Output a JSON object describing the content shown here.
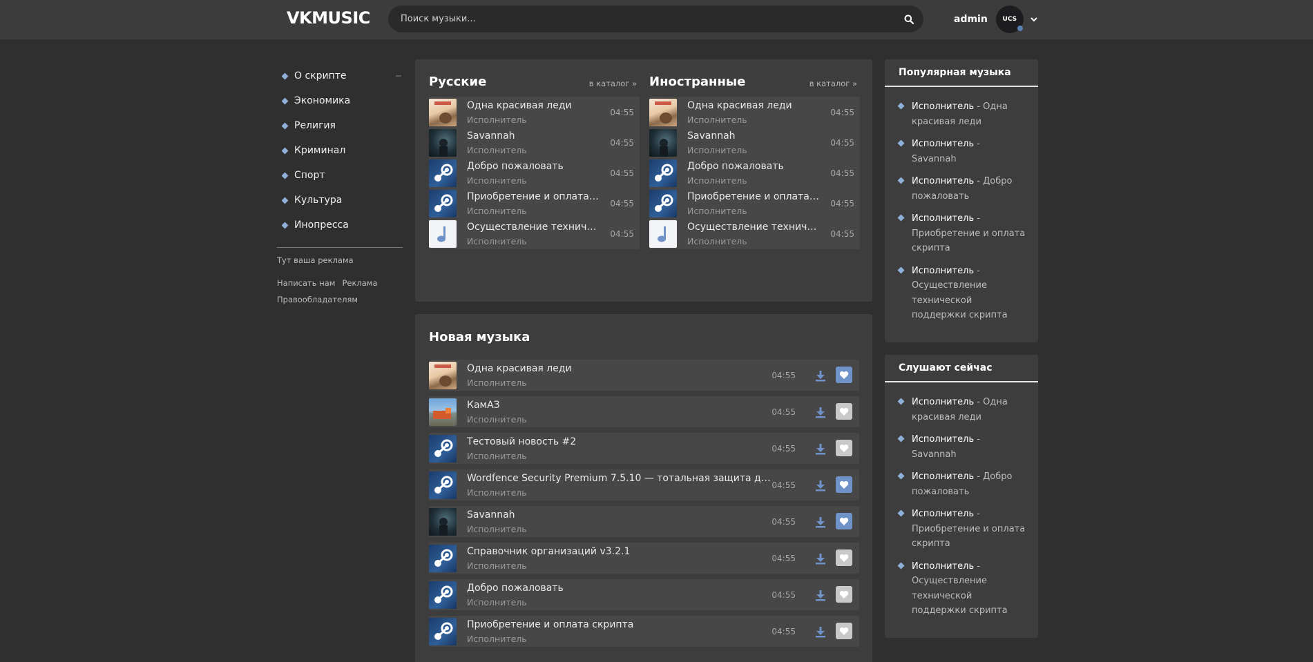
{
  "header": {
    "logo": "VKMUSIC",
    "search_placeholder": "Поиск музыки...",
    "user_name": "admin",
    "avatar_text": "UCS"
  },
  "sidebar": {
    "items": [
      {
        "label": "О скрипте"
      },
      {
        "label": "Экономика"
      },
      {
        "label": "Религия"
      },
      {
        "label": "Криминал"
      },
      {
        "label": "Спорт"
      },
      {
        "label": "Культура"
      },
      {
        "label": "Инопресса"
      }
    ],
    "ad_text": "Тут ваша реклама",
    "links": [
      "Написать нам",
      "Реклама",
      "Правообладателям"
    ]
  },
  "top": {
    "left_title": "Русские",
    "right_title": "Иностранные",
    "catalog_link": "в каталог »",
    "tracks": [
      {
        "title": "Одна красивая леди",
        "artist": "Исполнитель",
        "time": "04:55",
        "art": "lady"
      },
      {
        "title": "Savannah",
        "artist": "Исполнитель",
        "time": "04:55",
        "art": "sav"
      },
      {
        "title": "Добро пожаловать",
        "artist": "Исполнитель",
        "time": "04:55",
        "art": "steam"
      },
      {
        "title": "Приобретение и оплата с...",
        "artist": "Исполнитель",
        "time": "04:55",
        "art": "steam"
      },
      {
        "title": "Осуществление техничес...",
        "artist": "Исполнитель",
        "time": "04:55",
        "art": "note"
      }
    ]
  },
  "new_music": {
    "title": "Новая музыка",
    "tracks": [
      {
        "title": "Одна красивая леди",
        "artist": "Исполнитель",
        "time": "04:55",
        "art": "lady",
        "liked": true
      },
      {
        "title": "КамАЗ",
        "artist": "Исполнитель",
        "time": "04:55",
        "art": "kamaz",
        "liked": false
      },
      {
        "title": "Тестовый новость #2",
        "artist": "Исполнитель",
        "time": "04:55",
        "art": "steam",
        "liked": false
      },
      {
        "title": "Wordfence Security Premium 7.5.10 — тотальная защита для ...",
        "artist": "Исполнитель",
        "time": "04:55",
        "art": "steam",
        "liked": true
      },
      {
        "title": "Savannah",
        "artist": "Исполнитель",
        "time": "04:55",
        "art": "sav",
        "liked": true
      },
      {
        "title": "Справочник организаций v3.2.1",
        "artist": "Исполнитель",
        "time": "04:55",
        "art": "steam",
        "liked": false
      },
      {
        "title": "Добро пожаловать",
        "artist": "Исполнитель",
        "time": "04:55",
        "art": "steam",
        "liked": false
      },
      {
        "title": "Приобретение и оплата скрипта",
        "artist": "Исполнитель",
        "time": "04:55",
        "art": "steam",
        "liked": false
      }
    ]
  },
  "popular": {
    "title": "Популярная музыка",
    "items": [
      {
        "artist": "Исполнитель",
        "sep": " - ",
        "song": "Одна красивая леди"
      },
      {
        "artist": "Исполнитель",
        "sep": " - ",
        "song": "Savannah"
      },
      {
        "artist": "Исполнитель",
        "sep": " - ",
        "song": "Добро пожаловать"
      },
      {
        "artist": "Исполнитель",
        "sep": " - ",
        "song": "Приобретение и оплата скрипта"
      },
      {
        "artist": "Исполнитель",
        "sep": " - ",
        "song": "Осуществление технической поддержки скрипта"
      }
    ]
  },
  "listening": {
    "title": "Слушают сейчас",
    "items": [
      {
        "artist": "Исполнитель",
        "sep": " - ",
        "song": "Одна красивая леди"
      },
      {
        "artist": "Исполнитель",
        "sep": " - ",
        "song": "Savannah"
      },
      {
        "artist": "Исполнитель",
        "sep": " - ",
        "song": "Добро пожаловать"
      },
      {
        "artist": "Исполнитель",
        "sep": " - ",
        "song": "Приобретение и оплата скрипта"
      },
      {
        "artist": "Исполнитель",
        "sep": " - ",
        "song": "Осуществление технической поддержки скрипта"
      }
    ]
  },
  "colors": {
    "background": "#2f2f2f",
    "panel": "#3d3d3d",
    "row": "#474747",
    "accent": "#8fb0d9",
    "like_active": "#6f93c8",
    "like_inactive": "#c9c9c9"
  }
}
